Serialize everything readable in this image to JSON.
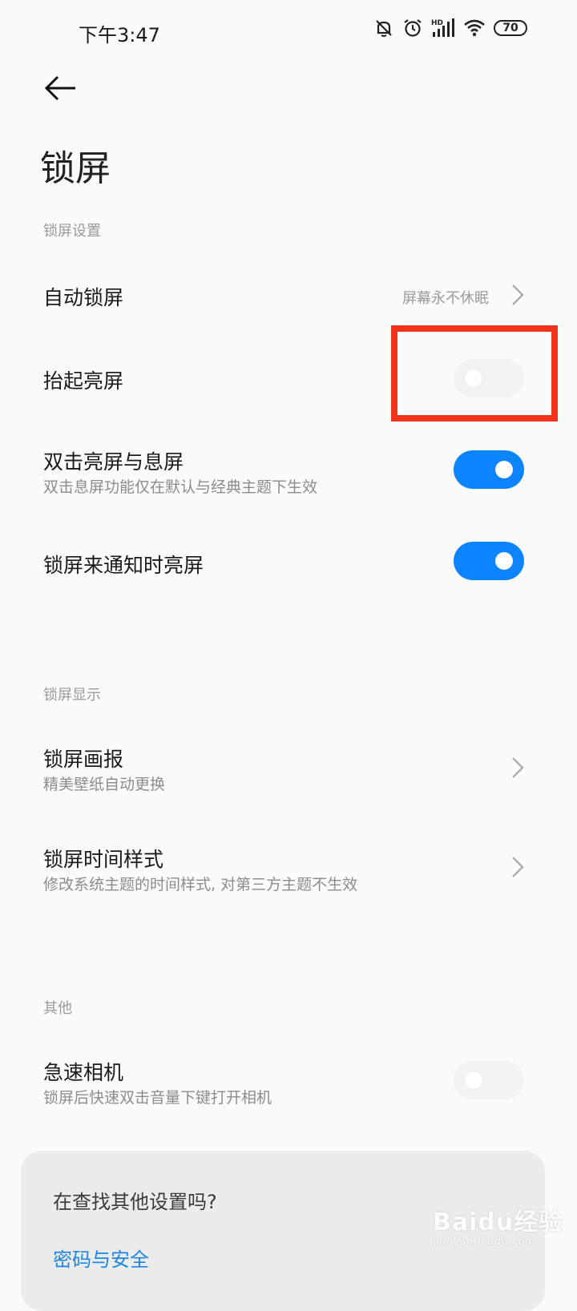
{
  "status_bar": {
    "time": "下午3:47",
    "network_label": "HD",
    "battery": "70",
    "icons": [
      "bell-off-icon",
      "alarm-icon",
      "signal-icon",
      "wifi-icon",
      "battery-icon"
    ]
  },
  "header": {
    "back_icon": "arrow-left-icon",
    "title": "锁屏"
  },
  "sections": {
    "lock_settings": {
      "label": "锁屏设置",
      "auto_lock": {
        "title": "自动锁屏",
        "value": "屏幕永不休眠"
      },
      "raise_to_wake": {
        "title": "抬起亮屏",
        "enabled": false
      },
      "double_tap": {
        "title": "双击亮屏与息屏",
        "subtitle": "双击息屏功能仅在默认与经典主题下生效",
        "enabled": true
      },
      "notification_wake": {
        "title": "锁屏来通知时亮屏",
        "enabled": true
      }
    },
    "lock_display": {
      "label": "锁屏显示",
      "wallpaper": {
        "title": "锁屏画报",
        "subtitle": "精美壁纸自动更换"
      },
      "clock_style": {
        "title": "锁屏时间样式",
        "subtitle": "修改系统主题的时间样式, 对第三方主题不生效"
      }
    },
    "other": {
      "label": "其他",
      "quick_camera": {
        "title": "急速相机",
        "subtitle": "锁屏后快速双击音量下键打开相机",
        "enabled": false
      }
    }
  },
  "bottom_card": {
    "question": "在查找其他设置吗?",
    "link": "密码与安全"
  },
  "watermark": {
    "main": "Baidu经验",
    "sub": "jingyan.baidu.com"
  },
  "colors": {
    "accent": "#0d84ff",
    "highlight": "#f2331c",
    "link": "#1d86e6"
  }
}
